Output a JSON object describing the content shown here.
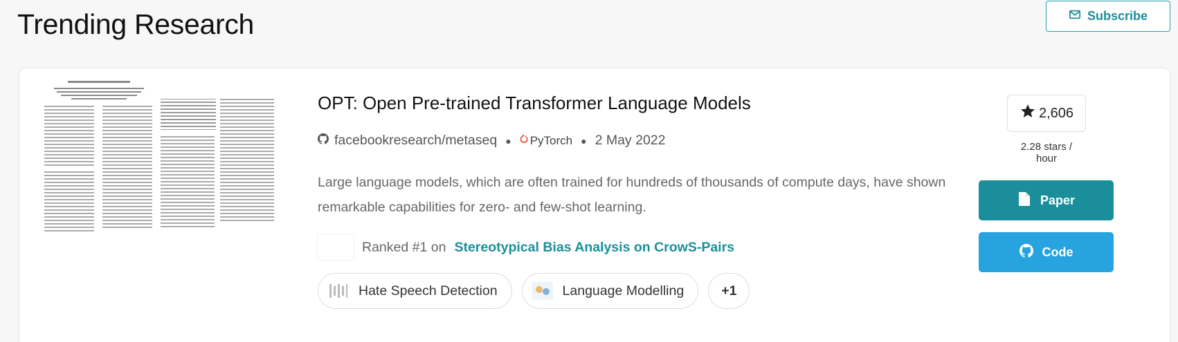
{
  "header": {
    "title": "Trending Research",
    "subscribe_label": "Subscribe"
  },
  "paper": {
    "title": "OPT: Open Pre-trained Transformer Language Models",
    "repo": "facebookresearch/metaseq",
    "framework": "PyTorch",
    "date": "2 May 2022",
    "abstract": "Large language models, which are often trained for hundreds of thousands of compute days, have shown remarkable capabilities for zero- and few-shot learning.",
    "ranked_prefix": "Ranked #1 on",
    "ranked_link": "Stereotypical Bias Analysis on CrowS-Pairs",
    "tasks": [
      "Hate Speech Detection",
      "Language Modelling"
    ],
    "more_tasks": "+1",
    "stars": "2,606",
    "stars_rate": "2.28 stars / hour",
    "paper_button": "Paper",
    "code_button": "Code"
  },
  "colors": {
    "accent": "#1a8f9b",
    "code_blue": "#27a3e0",
    "pytorch_orange": "#ee4c2c"
  },
  "icons": {
    "subscribe": "envelope-icon",
    "repo": "github-icon",
    "framework": "pytorch-icon",
    "stars": "star-icon",
    "paper": "file-icon",
    "code": "github-icon"
  }
}
